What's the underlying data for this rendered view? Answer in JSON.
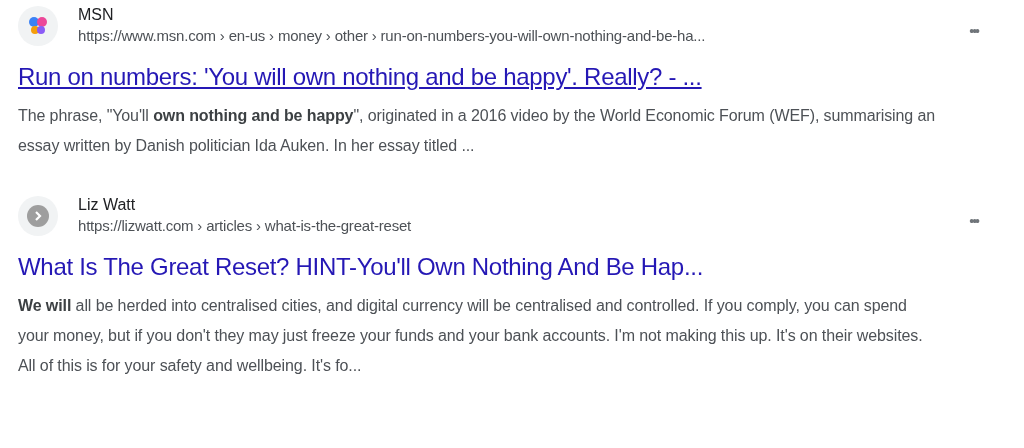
{
  "results": [
    {
      "kind": "msn",
      "source": "MSN",
      "url": "https://www.msn.com › en-us › money › other › run-on-numbers-you-will-own-nothing-and-be-ha...",
      "menu": "•••",
      "title": "Run on numbers: 'You will own nothing and be happy'. Really? - ...",
      "hovered": true,
      "snippet": "The phrase, \"You'll **own nothing and be happy**\", originated in a 2016 video by the World Economic Forum (WEF), summarising an essay written by Danish politician Ida Auken. In her essay titled ..."
    },
    {
      "kind": "generic",
      "source": "Liz Watt",
      "url": "https://lizwatt.com › articles › what-is-the-great-reset",
      "menu": "•••",
      "title": "What Is The Great Reset? HINT-You'll Own Nothing And Be Hap...",
      "hovered": false,
      "snippet": "**We will** all be herded into centralised cities, and digital currency will be centralised and controlled. If you comply, you can spend your money, but if you don't they may just freeze your funds and your bank accounts. I'm not making this up. It's on their websites. All of this is for your safety and wellbeing. It's fo..."
    }
  ]
}
